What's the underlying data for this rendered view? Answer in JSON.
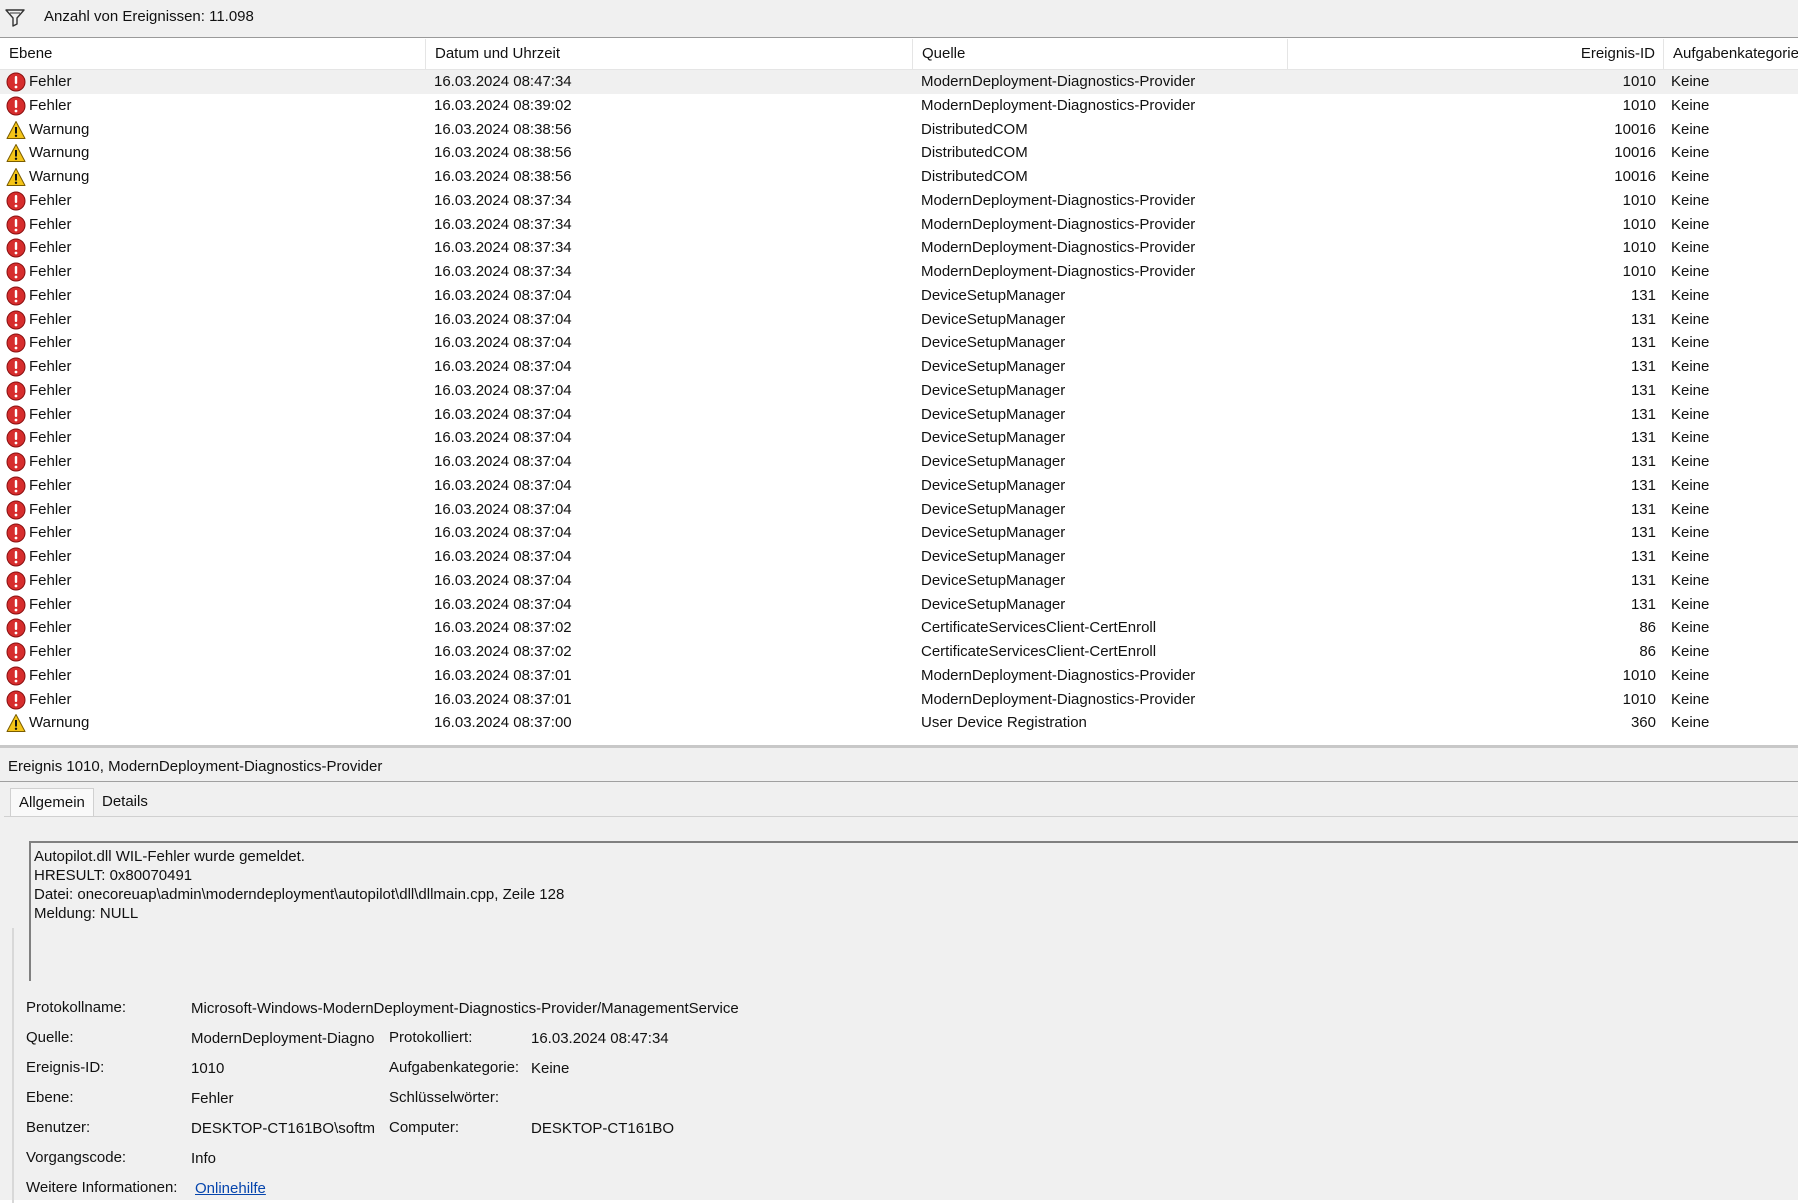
{
  "filter": {
    "icon": "filter-icon",
    "text": "Anzahl von Ereignissen: 11.098"
  },
  "columns": {
    "level": "Ebene",
    "datetime": "Datum und Uhrzeit",
    "source": "Quelle",
    "event_id": "Ereignis-ID",
    "category": "Aufgabenkategorie"
  },
  "level_icons": {
    "Fehler": "error-icon",
    "Warnung": "warning-icon"
  },
  "colors": {
    "error": "#d62d2d",
    "warning": "#f5c518",
    "selected_row": "#f0f0f0",
    "link": "#0645ad"
  },
  "rows": [
    {
      "level": "Fehler",
      "datetime": "16.03.2024 08:47:34",
      "source": "ModernDeployment-Diagnostics-Provider",
      "event_id": "1010",
      "category": "Keine"
    },
    {
      "level": "Fehler",
      "datetime": "16.03.2024 08:39:02",
      "source": "ModernDeployment-Diagnostics-Provider",
      "event_id": "1010",
      "category": "Keine"
    },
    {
      "level": "Warnung",
      "datetime": "16.03.2024 08:38:56",
      "source": "DistributedCOM",
      "event_id": "10016",
      "category": "Keine"
    },
    {
      "level": "Warnung",
      "datetime": "16.03.2024 08:38:56",
      "source": "DistributedCOM",
      "event_id": "10016",
      "category": "Keine"
    },
    {
      "level": "Warnung",
      "datetime": "16.03.2024 08:38:56",
      "source": "DistributedCOM",
      "event_id": "10016",
      "category": "Keine"
    },
    {
      "level": "Fehler",
      "datetime": "16.03.2024 08:37:34",
      "source": "ModernDeployment-Diagnostics-Provider",
      "event_id": "1010",
      "category": "Keine"
    },
    {
      "level": "Fehler",
      "datetime": "16.03.2024 08:37:34",
      "source": "ModernDeployment-Diagnostics-Provider",
      "event_id": "1010",
      "category": "Keine"
    },
    {
      "level": "Fehler",
      "datetime": "16.03.2024 08:37:34",
      "source": "ModernDeployment-Diagnostics-Provider",
      "event_id": "1010",
      "category": "Keine"
    },
    {
      "level": "Fehler",
      "datetime": "16.03.2024 08:37:34",
      "source": "ModernDeployment-Diagnostics-Provider",
      "event_id": "1010",
      "category": "Keine"
    },
    {
      "level": "Fehler",
      "datetime": "16.03.2024 08:37:04",
      "source": "DeviceSetupManager",
      "event_id": "131",
      "category": "Keine"
    },
    {
      "level": "Fehler",
      "datetime": "16.03.2024 08:37:04",
      "source": "DeviceSetupManager",
      "event_id": "131",
      "category": "Keine"
    },
    {
      "level": "Fehler",
      "datetime": "16.03.2024 08:37:04",
      "source": "DeviceSetupManager",
      "event_id": "131",
      "category": "Keine"
    },
    {
      "level": "Fehler",
      "datetime": "16.03.2024 08:37:04",
      "source": "DeviceSetupManager",
      "event_id": "131",
      "category": "Keine"
    },
    {
      "level": "Fehler",
      "datetime": "16.03.2024 08:37:04",
      "source": "DeviceSetupManager",
      "event_id": "131",
      "category": "Keine"
    },
    {
      "level": "Fehler",
      "datetime": "16.03.2024 08:37:04",
      "source": "DeviceSetupManager",
      "event_id": "131",
      "category": "Keine"
    },
    {
      "level": "Fehler",
      "datetime": "16.03.2024 08:37:04",
      "source": "DeviceSetupManager",
      "event_id": "131",
      "category": "Keine"
    },
    {
      "level": "Fehler",
      "datetime": "16.03.2024 08:37:04",
      "source": "DeviceSetupManager",
      "event_id": "131",
      "category": "Keine"
    },
    {
      "level": "Fehler",
      "datetime": "16.03.2024 08:37:04",
      "source": "DeviceSetupManager",
      "event_id": "131",
      "category": "Keine"
    },
    {
      "level": "Fehler",
      "datetime": "16.03.2024 08:37:04",
      "source": "DeviceSetupManager",
      "event_id": "131",
      "category": "Keine"
    },
    {
      "level": "Fehler",
      "datetime": "16.03.2024 08:37:04",
      "source": "DeviceSetupManager",
      "event_id": "131",
      "category": "Keine"
    },
    {
      "level": "Fehler",
      "datetime": "16.03.2024 08:37:04",
      "source": "DeviceSetupManager",
      "event_id": "131",
      "category": "Keine"
    },
    {
      "level": "Fehler",
      "datetime": "16.03.2024 08:37:04",
      "source": "DeviceSetupManager",
      "event_id": "131",
      "category": "Keine"
    },
    {
      "level": "Fehler",
      "datetime": "16.03.2024 08:37:04",
      "source": "DeviceSetupManager",
      "event_id": "131",
      "category": "Keine"
    },
    {
      "level": "Fehler",
      "datetime": "16.03.2024 08:37:02",
      "source": "CertificateServicesClient-CertEnroll",
      "event_id": "86",
      "category": "Keine"
    },
    {
      "level": "Fehler",
      "datetime": "16.03.2024 08:37:02",
      "source": "CertificateServicesClient-CertEnroll",
      "event_id": "86",
      "category": "Keine"
    },
    {
      "level": "Fehler",
      "datetime": "16.03.2024 08:37:01",
      "source": "ModernDeployment-Diagnostics-Provider",
      "event_id": "1010",
      "category": "Keine"
    },
    {
      "level": "Fehler",
      "datetime": "16.03.2024 08:37:01",
      "source": "ModernDeployment-Diagnostics-Provider",
      "event_id": "1010",
      "category": "Keine"
    },
    {
      "level": "Warnung",
      "datetime": "16.03.2024 08:37:00",
      "source": "User Device Registration",
      "event_id": "360",
      "category": "Keine"
    }
  ],
  "details": {
    "title": "Ereignis 1010, ModernDeployment-Diagnostics-Provider",
    "tabs": [
      "Allgemein",
      "Details"
    ],
    "description": [
      "Autopilot.dll WIL-Fehler wurde gemeldet.",
      "HRESULT: 0x80070491",
      "Datei: onecoreuap\\admin\\moderndeployment\\autopilot\\dll\\dllmain.cpp, Zeile 128",
      "Meldung:  NULL"
    ],
    "fields": {
      "log_name_label": "Protokollname:",
      "log_name": "Microsoft-Windows-ModernDeployment-Diagnostics-Provider/ManagementService",
      "source_label": "Quelle:",
      "source": "ModernDeployment-Diagno",
      "logged_label": "Protokolliert:",
      "logged": "16.03.2024 08:47:34",
      "event_id_label": "Ereignis-ID:",
      "event_id": "1010",
      "category_label": "Aufgabenkategorie:",
      "category": "Keine",
      "level_label": "Ebene:",
      "level": "Fehler",
      "keywords_label": "Schlüsselwörter:",
      "keywords": "",
      "user_label": "Benutzer:",
      "user": "DESKTOP-CT161BO\\softm",
      "computer_label": "Computer:",
      "computer": "DESKTOP-CT161BO",
      "opcode_label": "Vorgangscode:",
      "opcode": "Info",
      "more_info_label": "Weitere Informationen:",
      "more_info_link": "Onlinehilfe"
    }
  }
}
